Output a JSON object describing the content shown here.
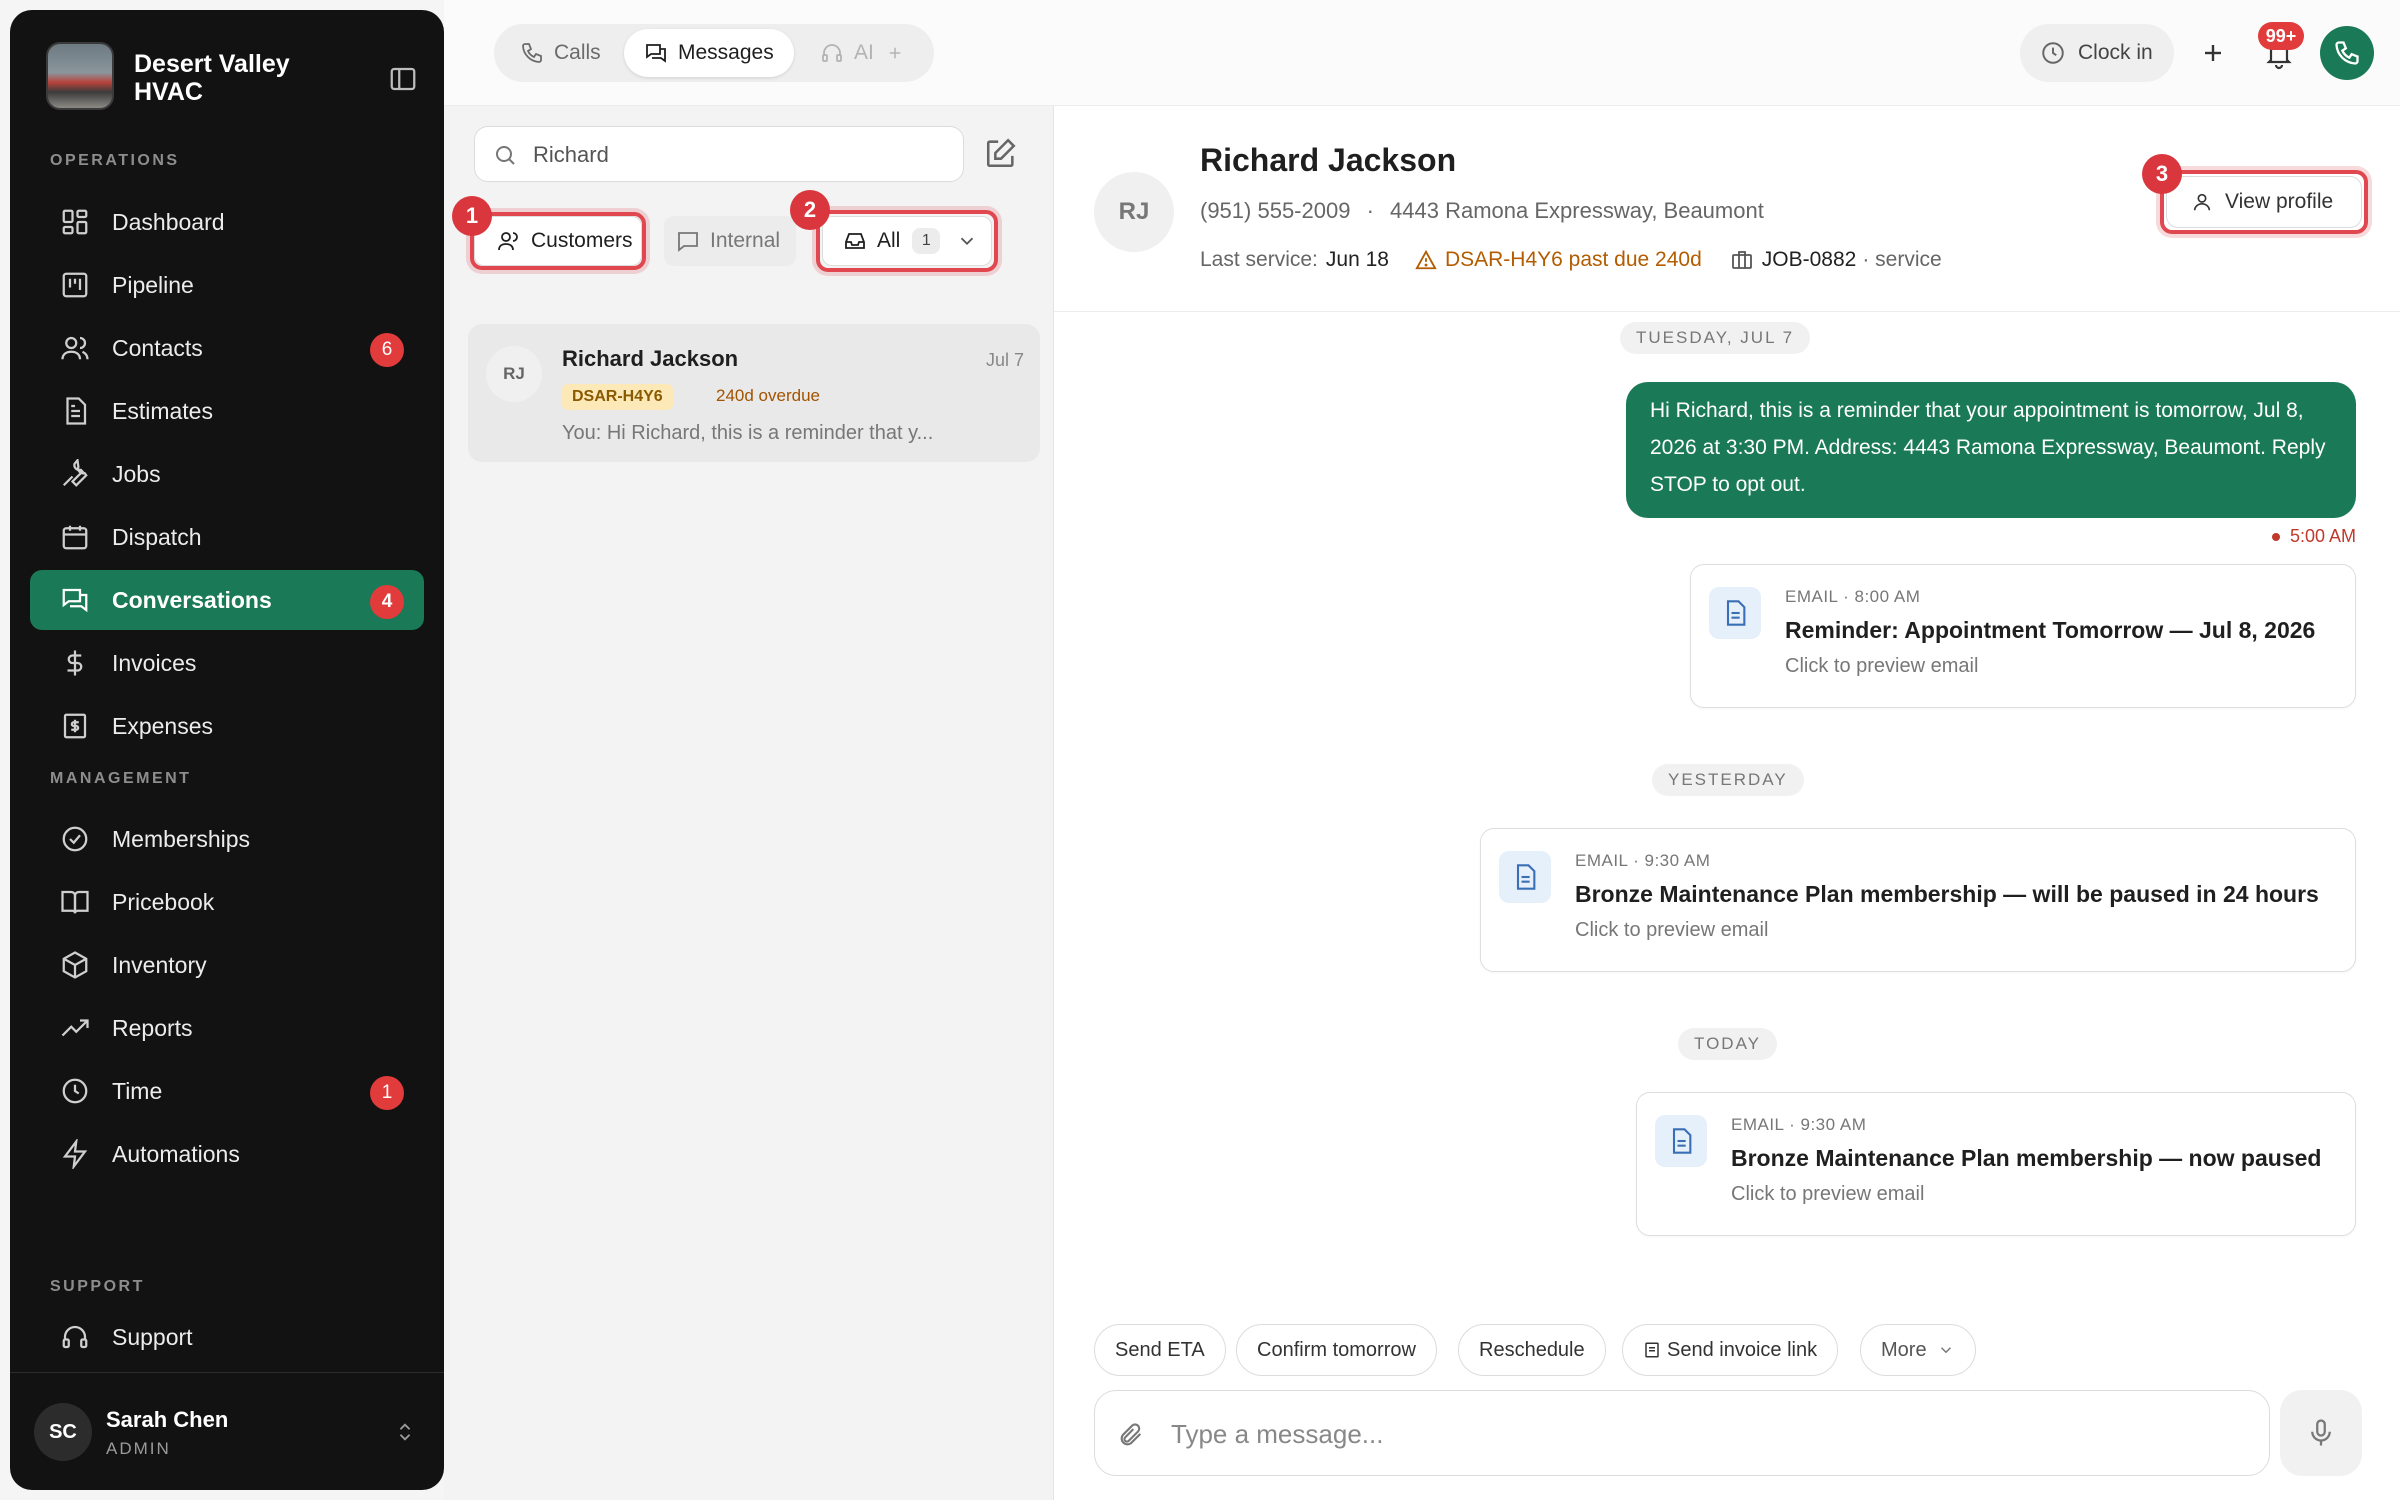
{
  "brand": {
    "name": "Desert Valley HVAC"
  },
  "sidebar": {
    "sections": {
      "operations": "OPERATIONS",
      "management": "MANAGEMENT",
      "support": "SUPPORT"
    },
    "items": [
      {
        "label": "Dashboard",
        "icon": "dashboard-icon"
      },
      {
        "label": "Pipeline",
        "icon": "pipeline-icon"
      },
      {
        "label": "Contacts",
        "icon": "contacts-icon",
        "badge": "6"
      },
      {
        "label": "Estimates",
        "icon": "estimates-icon"
      },
      {
        "label": "Jobs",
        "icon": "wrench-icon"
      },
      {
        "label": "Dispatch",
        "icon": "calendar-icon"
      },
      {
        "label": "Conversations",
        "icon": "chat-icon",
        "badge": "4",
        "active": true
      },
      {
        "label": "Invoices",
        "icon": "dollar-icon"
      },
      {
        "label": "Expenses",
        "icon": "receipt-icon"
      },
      {
        "label": "Memberships",
        "icon": "badge-check-icon"
      },
      {
        "label": "Pricebook",
        "icon": "book-icon"
      },
      {
        "label": "Inventory",
        "icon": "box-icon"
      },
      {
        "label": "Reports",
        "icon": "trend-icon"
      },
      {
        "label": "Time",
        "icon": "clock-icon",
        "badge": "1"
      },
      {
        "label": "Automations",
        "icon": "bolt-icon"
      },
      {
        "label": "Support",
        "icon": "headset-icon"
      }
    ],
    "user": {
      "initials": "SC",
      "name": "Sarah Chen",
      "role": "ADMIN"
    }
  },
  "topbar": {
    "tabs": [
      {
        "label": "Calls"
      },
      {
        "label": "Messages",
        "active": true
      },
      {
        "label": "AI",
        "disabled": true
      }
    ],
    "clock_in": "Clock in",
    "notif_badge": "99+"
  },
  "list": {
    "search_value": "Richard",
    "filters": {
      "customers": "Customers",
      "internal": "Internal",
      "all": "All",
      "all_count": "1"
    },
    "conversations": [
      {
        "initials": "RJ",
        "name": "Richard Jackson",
        "date": "Jul 7",
        "tag": "DSAR-H4Y6",
        "due": "240d overdue",
        "preview": "You: Hi Richard, this is a reminder that y..."
      }
    ]
  },
  "annotations": [
    "1",
    "2",
    "3"
  ],
  "detail": {
    "initials": "RJ",
    "name": "Richard Jackson",
    "phone": "(951) 555-2009",
    "separator": "·",
    "address": "4443 Ramona Expressway, Beaumont",
    "last_service_label": "Last service:",
    "last_service": "Jun 18",
    "overdue": "DSAR-H4Y6 past due 240d",
    "job": "JOB-0882",
    "job_type": "· service",
    "view_profile": "View profile",
    "days": [
      "TUESDAY, JUL 7",
      "YESTERDAY",
      "TODAY"
    ],
    "sms": {
      "text": "Hi Richard, this is a reminder that your appointment is tomorrow, Jul 8, 2026 at 3:30 PM. Address: 4443 Ramona Expressway, Beaumont. Reply STOP to opt out.",
      "time": "5:00 AM"
    },
    "emails": [
      {
        "label": "EMAIL · 8:00 AM",
        "subject": "Reminder: Appointment Tomorrow — Jul 8, 2026",
        "hint": "Click to preview email"
      },
      {
        "label": "EMAIL · 9:30 AM",
        "subject": "Bronze Maintenance Plan membership — will be paused in 24 hours",
        "hint": "Click to preview email"
      },
      {
        "label": "EMAIL · 9:30 AM",
        "subject": "Bronze Maintenance Plan membership — now paused",
        "hint": "Click to preview email"
      }
    ],
    "quick_actions": [
      "Send ETA",
      "Confirm tomorrow",
      "Reschedule",
      "Send invoice link",
      "More"
    ],
    "composer_placeholder": "Type a message..."
  },
  "colors": {
    "accent": "#1a7a57",
    "badge": "#e23b3b",
    "highlight": "#e0474f",
    "sidebar_bg": "#121212"
  }
}
